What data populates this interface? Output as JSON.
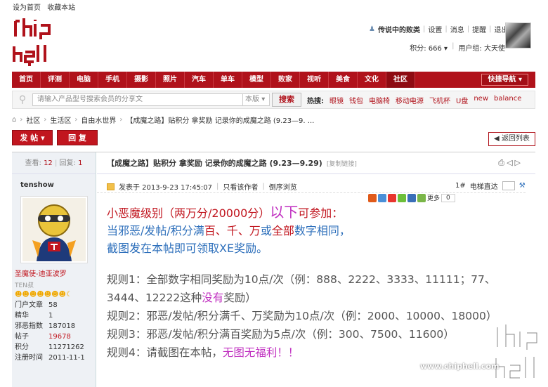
{
  "topbar": {
    "home": "设为首页",
    "fav": "收藏本站"
  },
  "user": {
    "name": "传说中的败类",
    "links": [
      "设置",
      "消息",
      "提醒",
      "退出"
    ],
    "points_label": "积分: 666",
    "group": "用户组: 大天使"
  },
  "nav": {
    "items": [
      "首页",
      "评测",
      "电脑",
      "手机",
      "摄影",
      "照片",
      "汽车",
      "单车",
      "模型",
      "败家",
      "视听",
      "美食",
      "文化",
      "社区"
    ],
    "active": "社区",
    "quick": "快捷导航"
  },
  "search": {
    "placeholder": "请输入产品型号搜索会员的分享文",
    "scope": "本版",
    "button": "搜索",
    "hot_label": "热搜:",
    "hot": [
      "眼镜",
      "钱包",
      "电脑椅",
      "移动电源",
      "飞机杯",
      "U盘",
      "new",
      "balance"
    ]
  },
  "breadcrumb": [
    "社区",
    "生活区",
    "自由水世界",
    "【成魔之路】贴积分 拿奖励 记录你的成魔之路 (9.23—9. ..."
  ],
  "actions": {
    "post": "发 帖",
    "reply": "回 复",
    "back": "返回列表"
  },
  "stats": {
    "views_label": "查看:",
    "views": "12",
    "replies_label": "回复:",
    "replies": "1"
  },
  "thread": {
    "title": "【成魔之路】贴积分 拿奖励 记录你的成魔之路 (9.23—9.29)",
    "copy_link": "[复制链接]"
  },
  "post": {
    "author": "tenshow",
    "time": "发表于 2013-9-23 17:45:07",
    "only_author": "只看该作者",
    "reverse": "倒序浏览",
    "floor": "1#",
    "jump": "电梯直达",
    "share_more": "更多",
    "share_count": "0"
  },
  "profile": {
    "group": "圣魔使-迪亚波罗",
    "rank": "TEN叔",
    "stars": "☻☻☻☻☻☻☻☾",
    "stats": [
      {
        "k": "门户文章",
        "v": "58"
      },
      {
        "k": "精华",
        "v": "1"
      },
      {
        "k": "邪恶指数",
        "v": "187018"
      },
      {
        "k": "帖子",
        "v": "19678"
      },
      {
        "k": "积分",
        "v": "11271262"
      },
      {
        "k": "注册时间",
        "v": "2011-11-1"
      }
    ]
  },
  "content": {
    "l1a": "小恶魔级别（两万分/20000分）",
    "l1b": "以下",
    "l1c": "可参加：",
    "l2a": "当邪恶/发帖/积分满",
    "l2b": "百、千、万",
    "l2c": "或",
    "l2d": "全部",
    "l2e": "数字相同，",
    "l3": "截图发在本帖即可领取XE奖励。",
    "r1a": "规则1：全部数字相同奖励为10点/次（例：888、2222、3333、11111；77、3444、12222这种",
    "r1b": "没有",
    "r1c": "奖励）",
    "r2": "规则2：邪恶/发帖/积分满千、万奖励为10点/次（例：2000、10000、18000）",
    "r3": "规则3：邪恶/发帖/积分满百奖励为5点/次（例：300、7500、11600）",
    "r4a": "规则4：请截图在本帖，",
    "r4b": "无图无福利！！"
  },
  "watermark": "www.chiphell.com",
  "colors": {
    "brand": "#b0121b",
    "accent_purple": "#c030c0",
    "link_blue": "#2d6fbb"
  }
}
